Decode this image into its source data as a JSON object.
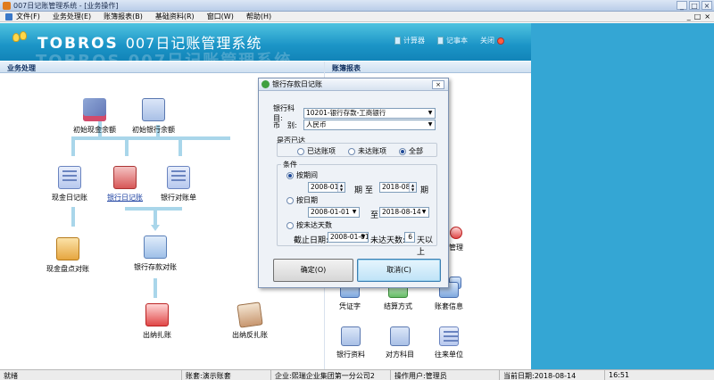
{
  "window": {
    "title": "007日记账管理系统 - [业务操作]",
    "controls": [
      "_",
      "□",
      "×"
    ]
  },
  "menu": {
    "items": [
      "文件(F)",
      "业务处理(E)",
      "账簿报表(B)",
      "基础资料(R)",
      "窗口(W)",
      "帮助(H)"
    ],
    "mdi_controls": [
      "_",
      "□",
      "×"
    ]
  },
  "banner": {
    "brand": "TOBROS",
    "subtitle": "007日记账管理系统",
    "ghost": "TOBROS 007日记账管理系统",
    "links": [
      {
        "label": "计算器",
        "icon": "calculator-icon"
      },
      {
        "label": "记事本",
        "icon": "notepad-icon"
      },
      {
        "label": "关闭",
        "icon": "close-icon"
      }
    ]
  },
  "sections": {
    "business": "业务处理",
    "reports": "账簿报表"
  },
  "flow": {
    "init_cash": "初始现金余额",
    "init_bank": "初始银行余额",
    "cash_journal": "现金日记账",
    "bank_journal": "银行日记账",
    "bank_statement": "银行对账单",
    "cash_check": "现金盘点对账",
    "bank_reconcile": "银行存款对账",
    "cashier_close": "出纳扎账",
    "cashier_unclose": "出纳反扎账"
  },
  "base": {
    "partial_label": "管理",
    "voucher": "凭证字",
    "settlement": "结算方式",
    "account_info": "账套信息",
    "bank_info": "银行资料",
    "counter_subject": "对方科目",
    "contact_unit": "往来单位"
  },
  "dialog": {
    "title": "银行存款日记账",
    "close": "×",
    "bank_subject_label": "银行科目:",
    "bank_subject_value": "10201-银行存款-工商银行",
    "currency_label": "币　别:",
    "currency_value": "人民币",
    "reconciled_group": "是否已达",
    "reconciled_options": [
      "已达账项",
      "未达账项",
      "全部"
    ],
    "reconciled_selected": 2,
    "conditions_group": "条件",
    "by_period": "按期间",
    "period_from": "2008-01",
    "period_mid": "期 至",
    "period_to": "2018-08",
    "period_suffix": "期",
    "by_date": "按日期",
    "date_from": "2008-01-01",
    "date_mid": "至",
    "date_to": "2018-08-14",
    "by_unreached": "按未达天数",
    "cutoff_label": "截止日期:",
    "cutoff_value": "2008-01-01",
    "unreached_label": "未达天数:",
    "unreached_days": "6",
    "unreached_suffix": "天以上",
    "condition_selected": 0,
    "ok": "确定(O)",
    "cancel": "取消(C)"
  },
  "status": {
    "state": "就绪",
    "account_label": "账套:",
    "account_value": "演示账套",
    "company_label": "企业:",
    "company_value": "熙瑞企业集团第一分公司2",
    "user_label": "操作用户:",
    "user_value": "管理员",
    "date_label": "当前日期:",
    "date_value": "2018-08-14",
    "time_value": "16:51"
  }
}
